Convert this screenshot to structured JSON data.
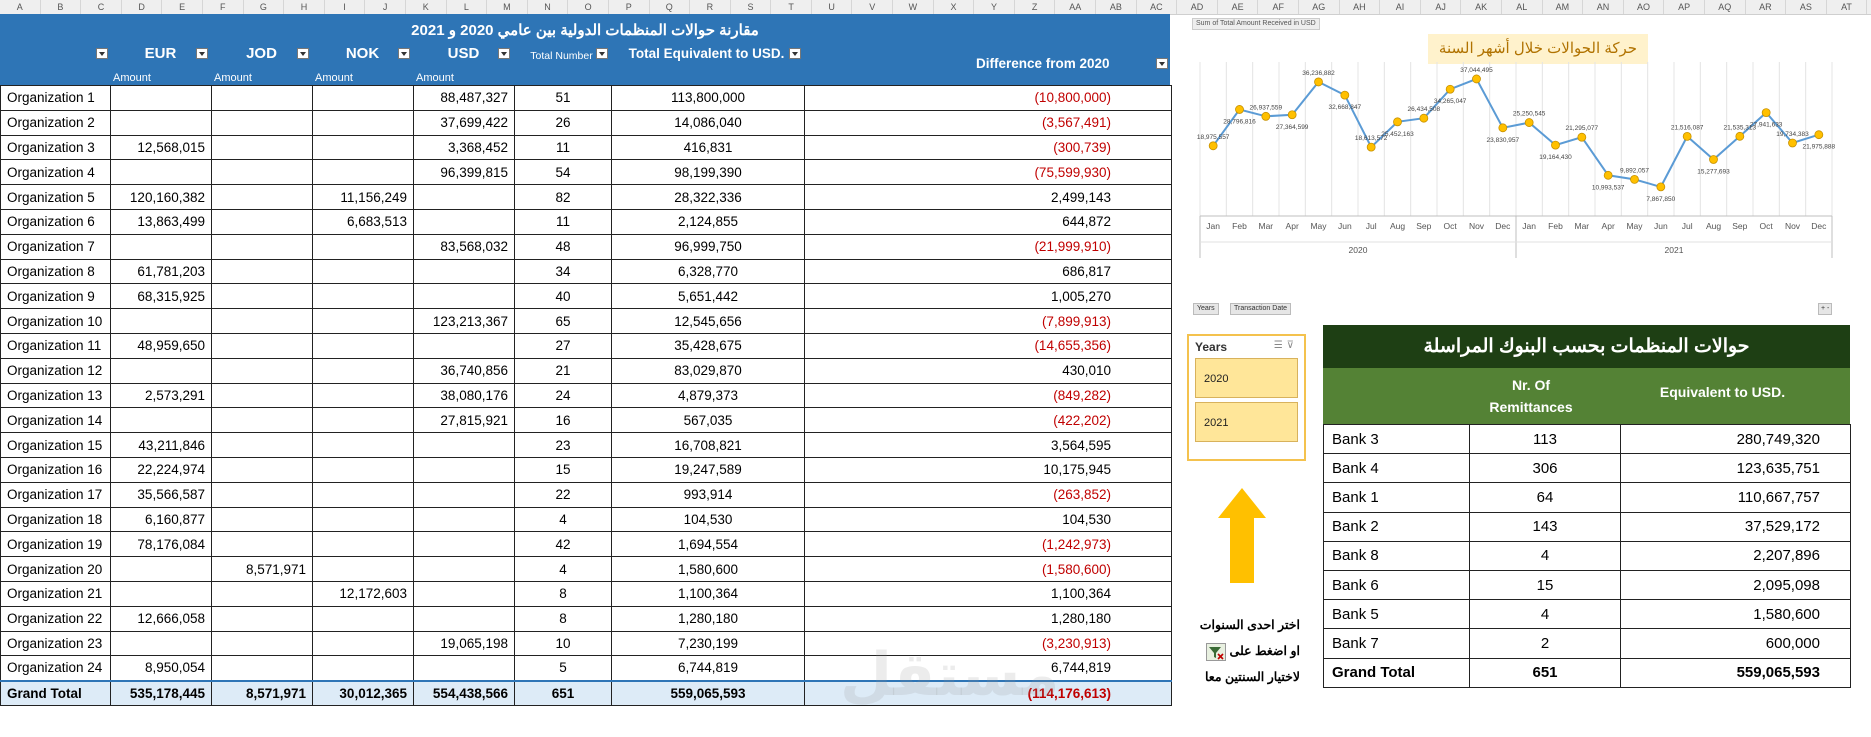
{
  "sheet_columns": [
    "A",
    "B",
    "C",
    "D",
    "E",
    "F",
    "G",
    "H",
    "I",
    "J",
    "K",
    "L",
    "M",
    "N",
    "O",
    "P",
    "Q",
    "R",
    "S",
    "T",
    "U",
    "V",
    "W",
    "X",
    "Y",
    "Z",
    "AA",
    "AB",
    "AC",
    "AD",
    "AE",
    "AF",
    "AG",
    "AH",
    "AI",
    "AJ",
    "AK",
    "AL",
    "AM",
    "AN",
    "AO",
    "AP",
    "AQ",
    "AR",
    "AS",
    "AT"
  ],
  "pivot": {
    "title": "مقارنة حوالات المنظمات الدولية بين عامي 2020 و 2021",
    "headers": {
      "eur": "EUR",
      "jod": "JOD",
      "nok": "NOK",
      "usd": "USD",
      "total_number": "Total Number",
      "total_equivalent": "Total Equivalent to USD.",
      "difference": "Difference  from 2020",
      "amount": "Amount"
    },
    "rows": [
      {
        "org": "Organization 1",
        "eur": "",
        "jod": "",
        "nok": "",
        "usd": "88,487,327",
        "count": "51",
        "equiv": "113,800,000",
        "diff": "(10,800,000)",
        "neg": true
      },
      {
        "org": "Organization 2",
        "eur": "",
        "jod": "",
        "nok": "",
        "usd": "37,699,422",
        "count": "26",
        "equiv": "14,086,040",
        "diff": "(3,567,491)",
        "neg": true
      },
      {
        "org": "Organization 3",
        "eur": "12,568,015",
        "jod": "",
        "nok": "",
        "usd": "3,368,452",
        "count": "11",
        "equiv": "416,831",
        "diff": "(300,739)",
        "neg": true
      },
      {
        "org": "Organization 4",
        "eur": "",
        "jod": "",
        "nok": "",
        "usd": "96,399,815",
        "count": "54",
        "equiv": "98,199,390",
        "diff": "(75,599,930)",
        "neg": true
      },
      {
        "org": "Organization 5",
        "eur": "120,160,382",
        "jod": "",
        "nok": "11,156,249",
        "usd": "",
        "count": "82",
        "equiv": "28,322,336",
        "diff": "2,499,143",
        "neg": false
      },
      {
        "org": "Organization 6",
        "eur": "13,863,499",
        "jod": "",
        "nok": "6,683,513",
        "usd": "",
        "count": "11",
        "equiv": "2,124,855",
        "diff": "644,872",
        "neg": false
      },
      {
        "org": "Organization 7",
        "eur": "",
        "jod": "",
        "nok": "",
        "usd": "83,568,032",
        "count": "48",
        "equiv": "96,999,750",
        "diff": "(21,999,910)",
        "neg": true
      },
      {
        "org": "Organization 8",
        "eur": "61,781,203",
        "jod": "",
        "nok": "",
        "usd": "",
        "count": "34",
        "equiv": "6,328,770",
        "diff": "686,817",
        "neg": false
      },
      {
        "org": "Organization 9",
        "eur": "68,315,925",
        "jod": "",
        "nok": "",
        "usd": "",
        "count": "40",
        "equiv": "5,651,442",
        "diff": "1,005,270",
        "neg": false
      },
      {
        "org": "Organization 10",
        "eur": "",
        "jod": "",
        "nok": "",
        "usd": "123,213,367",
        "count": "65",
        "equiv": "12,545,656",
        "diff": "(7,899,913)",
        "neg": true
      },
      {
        "org": "Organization 11",
        "eur": "48,959,650",
        "jod": "",
        "nok": "",
        "usd": "",
        "count": "27",
        "equiv": "35,428,675",
        "diff": "(14,655,356)",
        "neg": true
      },
      {
        "org": "Organization 12",
        "eur": "",
        "jod": "",
        "nok": "",
        "usd": "36,740,856",
        "count": "21",
        "equiv": "83,029,870",
        "diff": "430,010",
        "neg": false
      },
      {
        "org": "Organization 13",
        "eur": "2,573,291",
        "jod": "",
        "nok": "",
        "usd": "38,080,176",
        "count": "24",
        "equiv": "4,879,373",
        "diff": "(849,282)",
        "neg": true
      },
      {
        "org": "Organization 14",
        "eur": "",
        "jod": "",
        "nok": "",
        "usd": "27,815,921",
        "count": "16",
        "equiv": "567,035",
        "diff": "(422,202)",
        "neg": true
      },
      {
        "org": "Organization 15",
        "eur": "43,211,846",
        "jod": "",
        "nok": "",
        "usd": "",
        "count": "23",
        "equiv": "16,708,821",
        "diff": "3,564,595",
        "neg": false
      },
      {
        "org": "Organization 16",
        "eur": "22,224,974",
        "jod": "",
        "nok": "",
        "usd": "",
        "count": "15",
        "equiv": "19,247,589",
        "diff": "10,175,945",
        "neg": false
      },
      {
        "org": "Organization 17",
        "eur": "35,566,587",
        "jod": "",
        "nok": "",
        "usd": "",
        "count": "22",
        "equiv": "993,914",
        "diff": "(263,852)",
        "neg": true
      },
      {
        "org": "Organization 18",
        "eur": "6,160,877",
        "jod": "",
        "nok": "",
        "usd": "",
        "count": "4",
        "equiv": "104,530",
        "diff": "104,530",
        "neg": false
      },
      {
        "org": "Organization 19",
        "eur": "78,176,084",
        "jod": "",
        "nok": "",
        "usd": "",
        "count": "42",
        "equiv": "1,694,554",
        "diff": "(1,242,973)",
        "neg": true
      },
      {
        "org": "Organization 20",
        "eur": "",
        "jod": "8,571,971",
        "nok": "",
        "usd": "",
        "count": "4",
        "equiv": "1,580,600",
        "diff": "(1,580,600)",
        "neg": true
      },
      {
        "org": "Organization 21",
        "eur": "",
        "jod": "",
        "nok": "12,172,603",
        "usd": "",
        "count": "8",
        "equiv": "1,100,364",
        "diff": "1,100,364",
        "neg": false
      },
      {
        "org": "Organization 22",
        "eur": "12,666,058",
        "jod": "",
        "nok": "",
        "usd": "",
        "count": "8",
        "equiv": "1,280,180",
        "diff": "1,280,180",
        "neg": false
      },
      {
        "org": "Organization 23",
        "eur": "",
        "jod": "",
        "nok": "",
        "usd": "19,065,198",
        "count": "10",
        "equiv": "7,230,199",
        "diff": "(3,230,913)",
        "neg": true
      },
      {
        "org": "Organization 24",
        "eur": "8,950,054",
        "jod": "",
        "nok": "",
        "usd": "",
        "count": "5",
        "equiv": "6,744,819",
        "diff": "6,744,819",
        "neg": false
      }
    ],
    "total": {
      "org": "Grand Total",
      "eur": "535,178,445",
      "jod": "8,571,971",
      "nok": "30,012,365",
      "usd": "554,438,566",
      "count": "651",
      "equiv": "559,065,593",
      "diff": "(114,176,613)",
      "neg": true
    }
  },
  "chart_data": {
    "type": "line",
    "title": "حركة الحوالات خلال أشهر السنة",
    "tag": "Sum of Total Amount Received in USD",
    "categories": [
      "Jan",
      "Feb",
      "Mar",
      "Apr",
      "May",
      "Jun",
      "Jul",
      "Aug",
      "Sep",
      "Oct",
      "Nov",
      "Dec",
      "Jan",
      "Feb",
      "Mar",
      "Apr",
      "May",
      "Jun",
      "Jul",
      "Aug",
      "Sep",
      "Oct",
      "Nov",
      "Dec"
    ],
    "groups": [
      "2020",
      "2021"
    ],
    "values": [
      18975557,
      28796816,
      26937559,
      27364599,
      36236882,
      32668847,
      18613572,
      25452163,
      26434508,
      34265047,
      37044495,
      23830957,
      25250545,
      19164430,
      21295077,
      10993537,
      9892057,
      7867850,
      21516087,
      15277693,
      21535313,
      27941633,
      19734383,
      21975888
    ],
    "labels": [
      "18,975,557",
      "28,796,816",
      "26,937,559",
      "27,364,599",
      "36,236,882",
      "32,668,847",
      "18,613,572",
      "25,452,163",
      "26,434,508",
      "34,265,047",
      "37,044,495",
      "23,830,957",
      "25,250,545",
      "19,164,430",
      "21,295,077",
      "10,993,537",
      "9,892,057",
      "7,867,850",
      "21,516,087",
      "15,277,693",
      "21,535,313",
      "27,941,633",
      "19,734,383",
      "21,975,888"
    ],
    "ylim": [
      0,
      40000000
    ],
    "grid": true,
    "line_color": "#5b9bd5",
    "marker_color": "#ffc000",
    "filter_chips": [
      "Years",
      "Transaction Date"
    ]
  },
  "slicer": {
    "title": "Years",
    "items": [
      "2020",
      "2021"
    ]
  },
  "instructions": {
    "line1": "اختر احدى السنوات",
    "line2": "او اضغط على",
    "line3": "لاختيار السنتين معا"
  },
  "banks": {
    "title": "حوالات المنظمات بحسب البنوك المراسلة",
    "headers": {
      "count_line1": "Nr. Of",
      "count_line2": "Remittances",
      "equiv": "Equivalent to USD."
    },
    "rows": [
      {
        "name": "Bank 3",
        "count": "113",
        "equiv": "280,749,320"
      },
      {
        "name": "Bank 4",
        "count": "306",
        "equiv": "123,635,751"
      },
      {
        "name": "Bank 1",
        "count": "64",
        "equiv": "110,667,757"
      },
      {
        "name": "Bank 2",
        "count": "143",
        "equiv": "37,529,172"
      },
      {
        "name": "Bank 8",
        "count": "4",
        "equiv": "2,207,896"
      },
      {
        "name": "Bank 6",
        "count": "15",
        "equiv": "2,095,098"
      },
      {
        "name": "Bank 5",
        "count": "4",
        "equiv": "1,580,600"
      },
      {
        "name": "Bank 7",
        "count": "2",
        "equiv": "600,000"
      }
    ],
    "total": {
      "name": "Grand Total",
      "count": "651",
      "equiv": "559,065,593"
    }
  },
  "colors": {
    "blue": "#2e75b6",
    "green": "#548235",
    "dark_green": "#1e3f14",
    "neg": "#c00000",
    "slicer": "#ffe699",
    "arrow": "#ffc000"
  }
}
